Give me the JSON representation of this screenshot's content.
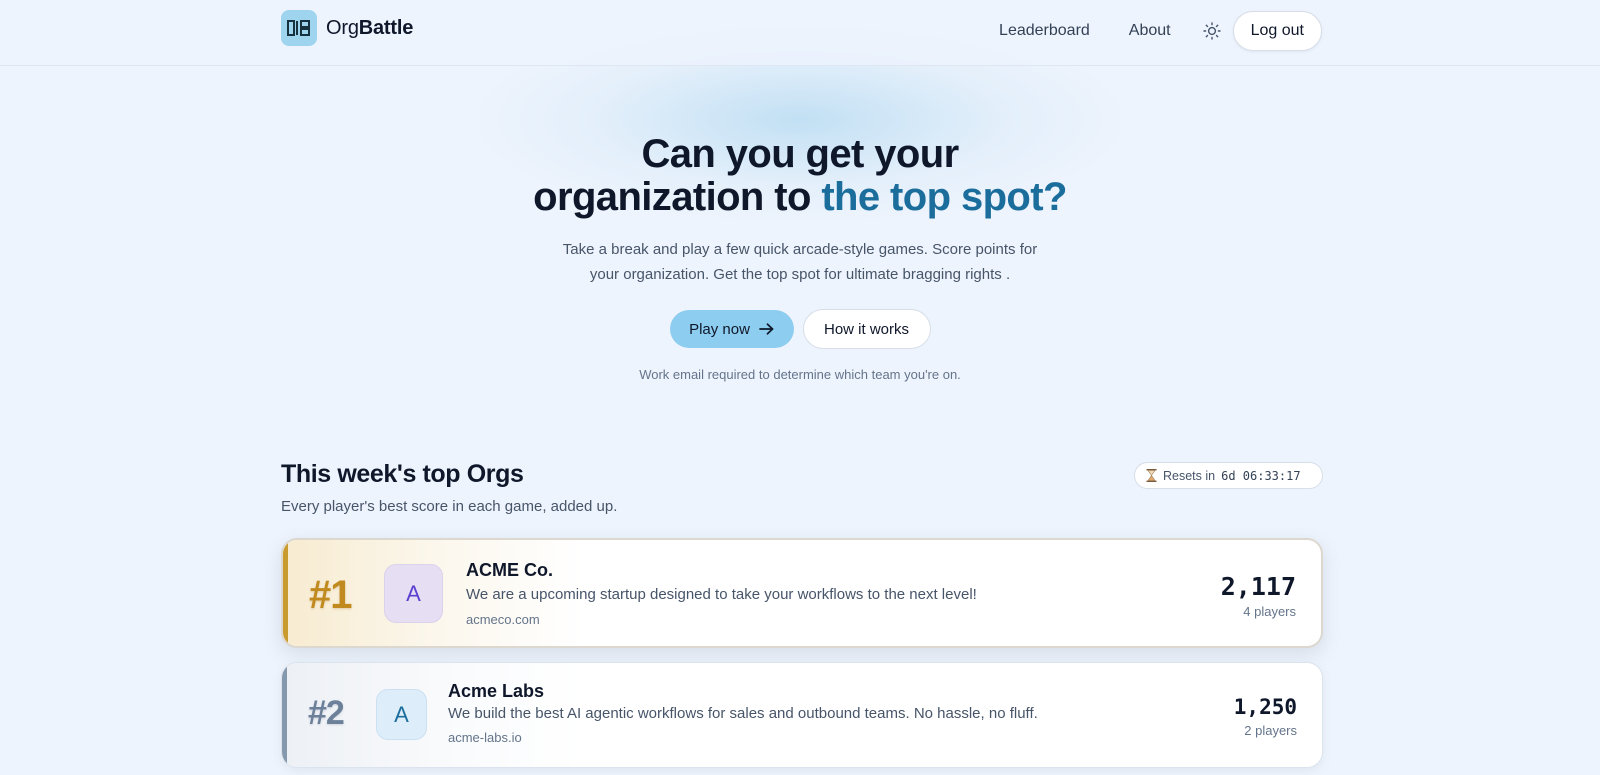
{
  "header": {
    "logo_name_regular": "Org",
    "logo_name_bold": "Battle",
    "nav": {
      "leaderboard": "Leaderboard",
      "about": "About",
      "logout": "Log out"
    },
    "theme_icon": "sun-icon"
  },
  "hero": {
    "title_line1": "Can you get your",
    "title_line2_plain": "organization to ",
    "title_line2_accent": "the top spot?",
    "subtitle": "Take a break and play a few quick arcade-style games. Score points for your organization. Get the top spot for ultimate bragging rights .",
    "play_label": "Play now",
    "how_label": "How it works",
    "note": "Work email required to determine which team you're on."
  },
  "leaderboard": {
    "title": "This week's top Orgs",
    "subtitle": "Every player's best score in each game, added up.",
    "reset_label": "Resets in",
    "reset_time": "6d 06:33:17",
    "orgs": [
      {
        "rank": "#1",
        "avatar": "A",
        "name": "ACME Co.",
        "description": "We are a upcoming startup designed to take your workflows to the next level!",
        "domain": "acmeco.com",
        "score": "2,117",
        "players": "4 players"
      },
      {
        "rank": "#2",
        "avatar": "A",
        "name": "Acme Labs",
        "description": "We build the best AI agentic workflows for sales and outbound teams. No hassle, no fluff.",
        "domain": "acme-labs.io",
        "score": "1,250",
        "players": "2 players"
      }
    ]
  },
  "colors": {
    "accent": "#1b6d9c",
    "play_button": "#8dcdef",
    "gold": "#c08a1f",
    "silver": "#6c809a",
    "background": "#eef4fd"
  }
}
